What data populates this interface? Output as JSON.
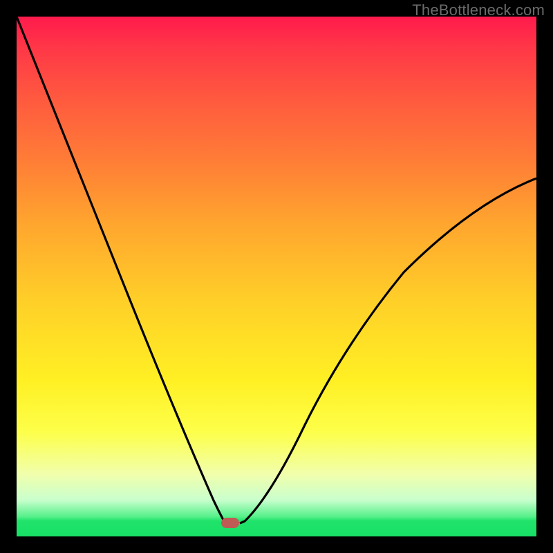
{
  "watermark": "TheBottleneck.com",
  "colors": {
    "frame": "#000000",
    "curve": "#000000",
    "marker": "#c05a54",
    "gradient_top": "#ff1a4c",
    "gradient_bottom": "#17e065"
  },
  "marker": {
    "x_frac": 0.408,
    "y_frac": 0.975
  },
  "chart_data": {
    "type": "line",
    "title": "",
    "xlabel": "",
    "ylabel": "",
    "xlim": [
      0,
      1
    ],
    "ylim": [
      0,
      1
    ],
    "x": [
      0.0,
      0.05,
      0.1,
      0.15,
      0.2,
      0.25,
      0.3,
      0.35,
      0.375,
      0.395,
      0.405,
      0.43,
      0.44,
      0.47,
      0.52,
      0.58,
      0.65,
      0.72,
      0.8,
      0.88,
      0.94,
      1.0
    ],
    "values": [
      1.0,
      0.875,
      0.75,
      0.625,
      0.5,
      0.375,
      0.255,
      0.135,
      0.075,
      0.03,
      0.025,
      0.025,
      0.03,
      0.06,
      0.135,
      0.225,
      0.325,
      0.415,
      0.505,
      0.585,
      0.635,
      0.685
    ],
    "annotations": [
      {
        "type": "marker",
        "x": 0.408,
        "y": 0.025,
        "label": ""
      }
    ]
  }
}
